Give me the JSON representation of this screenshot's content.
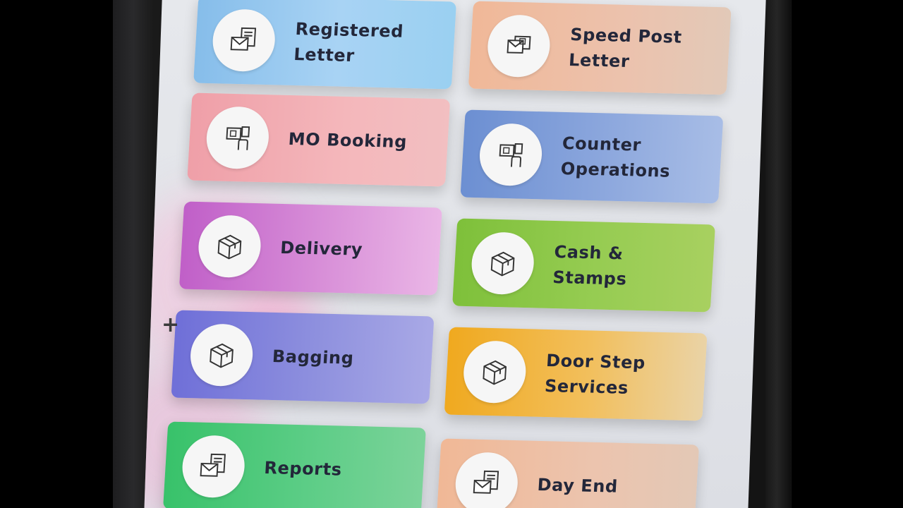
{
  "menu": {
    "tiles": [
      {
        "label": "Registered\nLetter",
        "icon": "envelope-letter-icon",
        "color": "#9fcdf2"
      },
      {
        "label": "Speed Post\nLetter",
        "icon": "speed-post-stamp-icon",
        "color": "#ecc2ab"
      },
      {
        "label": "MO Booking",
        "icon": "money-order-hand-icon",
        "color": "#f3b3b7"
      },
      {
        "label": "Counter\nOperations",
        "icon": "counter-hand-icon",
        "color": "#8da8de"
      },
      {
        "label": "Delivery",
        "icon": "parcel-box-icon",
        "color": "#d98fd9"
      },
      {
        "label": "Cash & Stamps",
        "icon": "parcel-box-icon",
        "color": "#93c94e"
      },
      {
        "label": "Bagging",
        "icon": "parcel-box-icon",
        "color": "#8f90df"
      },
      {
        "label": "Door Step\nServices",
        "icon": "parcel-box-icon",
        "color": "#f0bf5d"
      },
      {
        "label": "Reports",
        "icon": "envelope-letter-icon",
        "color": "#5ccd86"
      },
      {
        "label": "Day End",
        "icon": "envelope-letter-icon",
        "color": "#ecc4ae"
      }
    ]
  },
  "overlay": {
    "plus_glyph": "+"
  }
}
